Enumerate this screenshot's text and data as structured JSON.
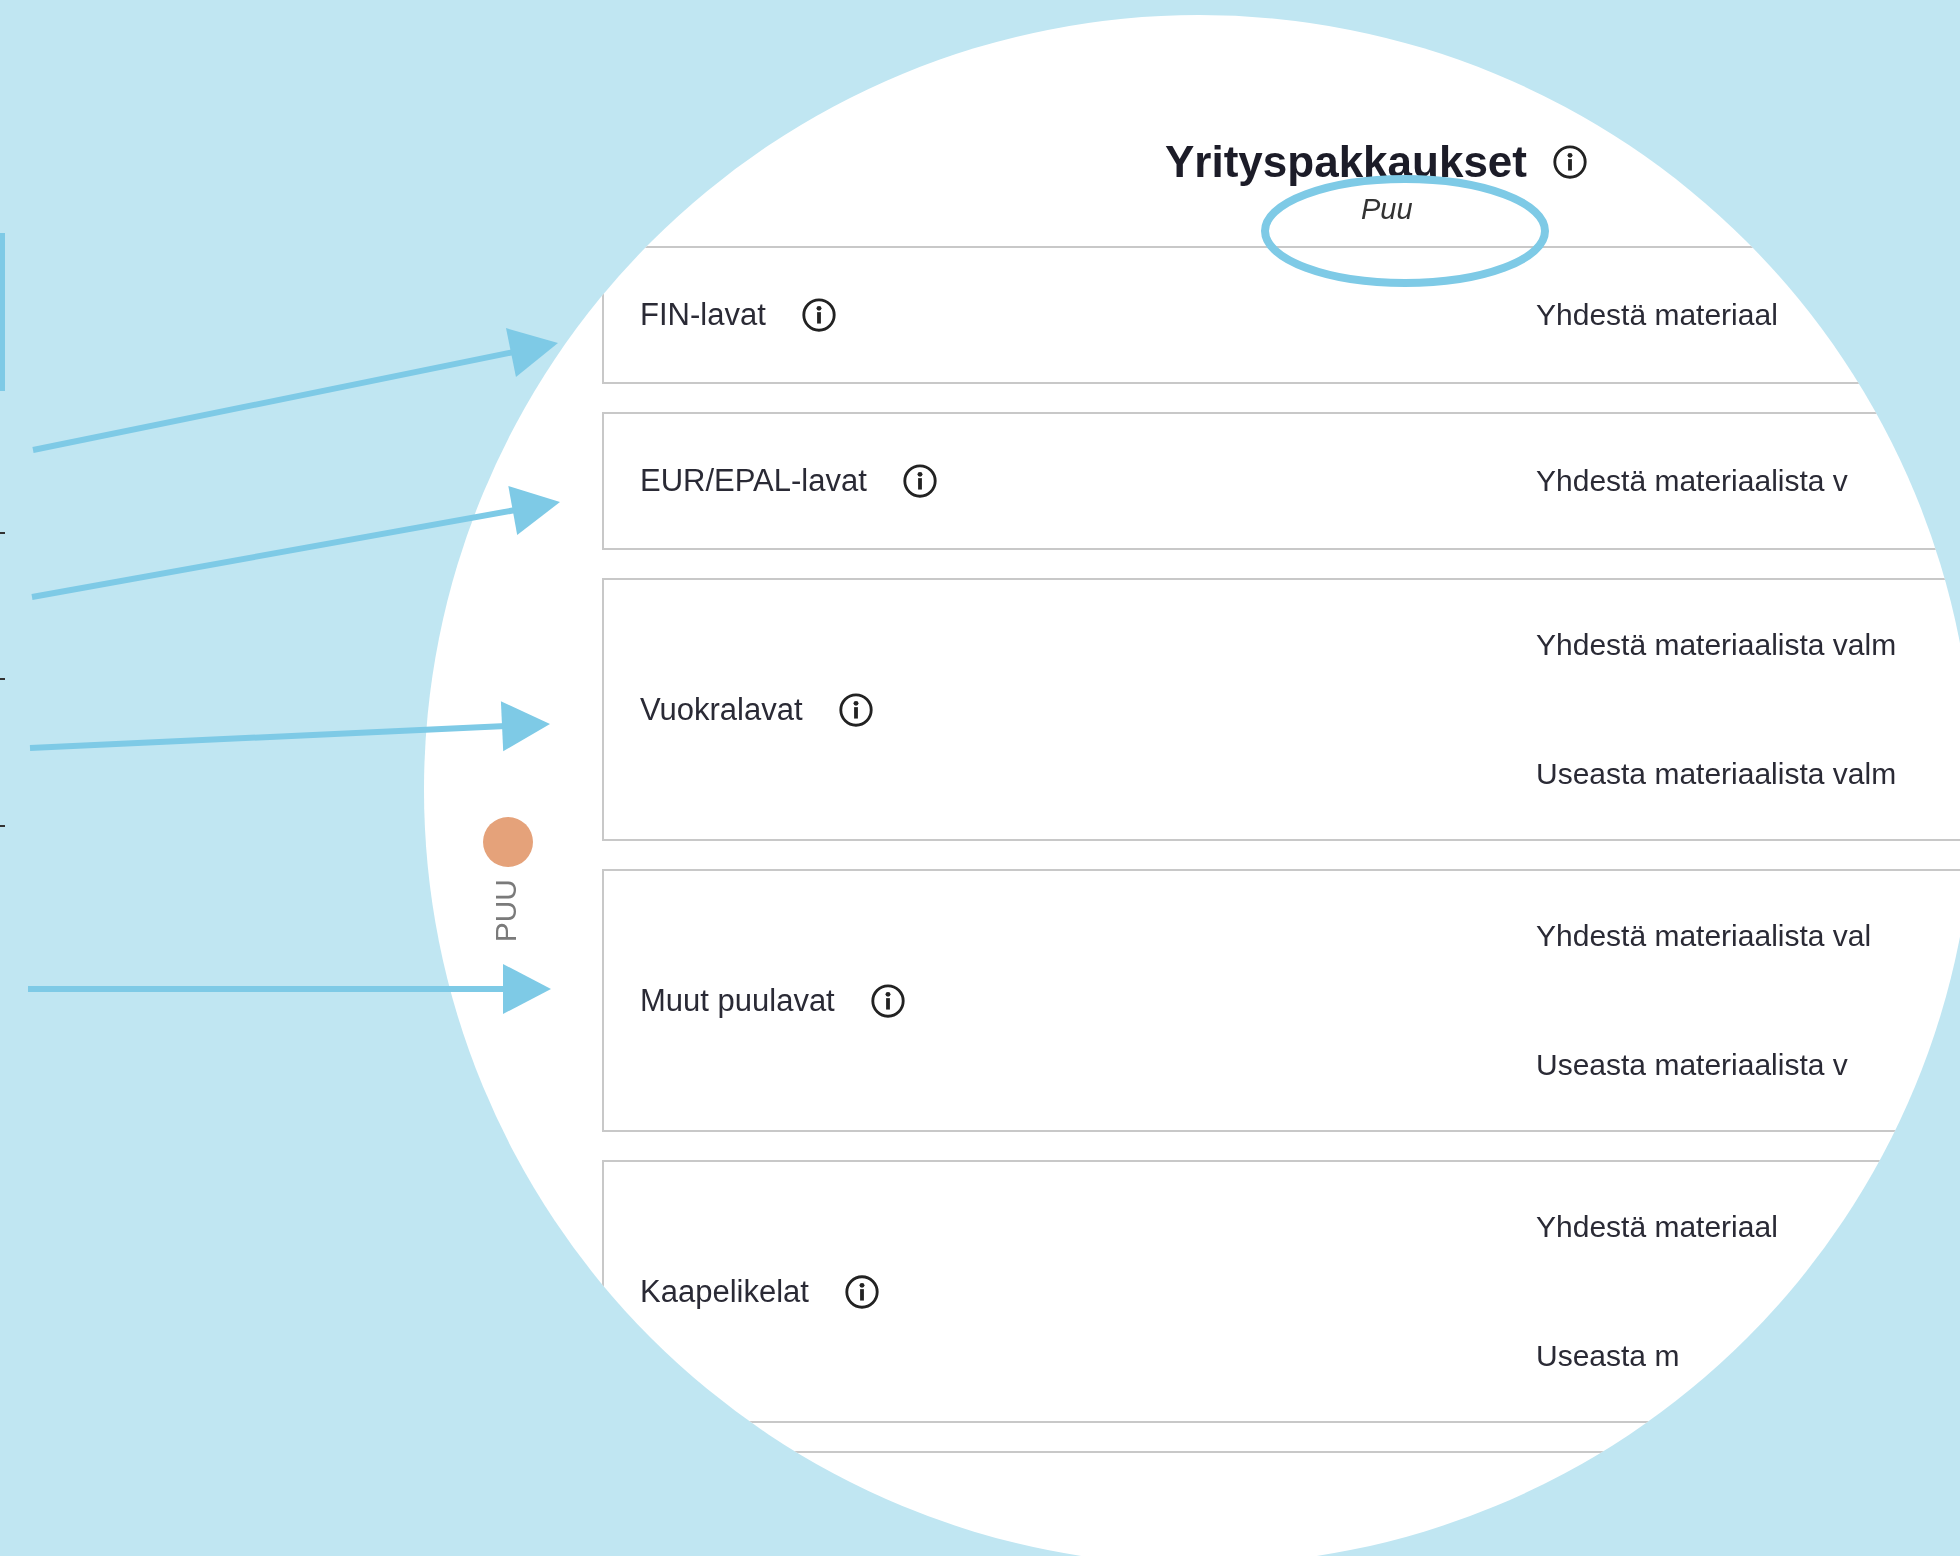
{
  "header": {
    "title": "Yrityspakkaukset",
    "subtitle": "Puu"
  },
  "side_label": "PUU",
  "categories": [
    {
      "label": "FIN-lavat",
      "options": [
        "Yhdestä materiaal"
      ]
    },
    {
      "label": "EUR/EPAL-lavat",
      "options": [
        "Yhdestä materiaalista v"
      ]
    },
    {
      "label": "Vuokralavat",
      "options": [
        "Yhdestä materiaalista valm",
        "Useasta materiaalista valm"
      ]
    },
    {
      "label": "Muut puulavat",
      "options": [
        "Yhdestä materiaalista val",
        "Useasta materiaalista v"
      ]
    },
    {
      "label": "Kaapelikelat",
      "options": [
        "Yhdestä materiaal",
        "Useasta m"
      ]
    }
  ]
}
